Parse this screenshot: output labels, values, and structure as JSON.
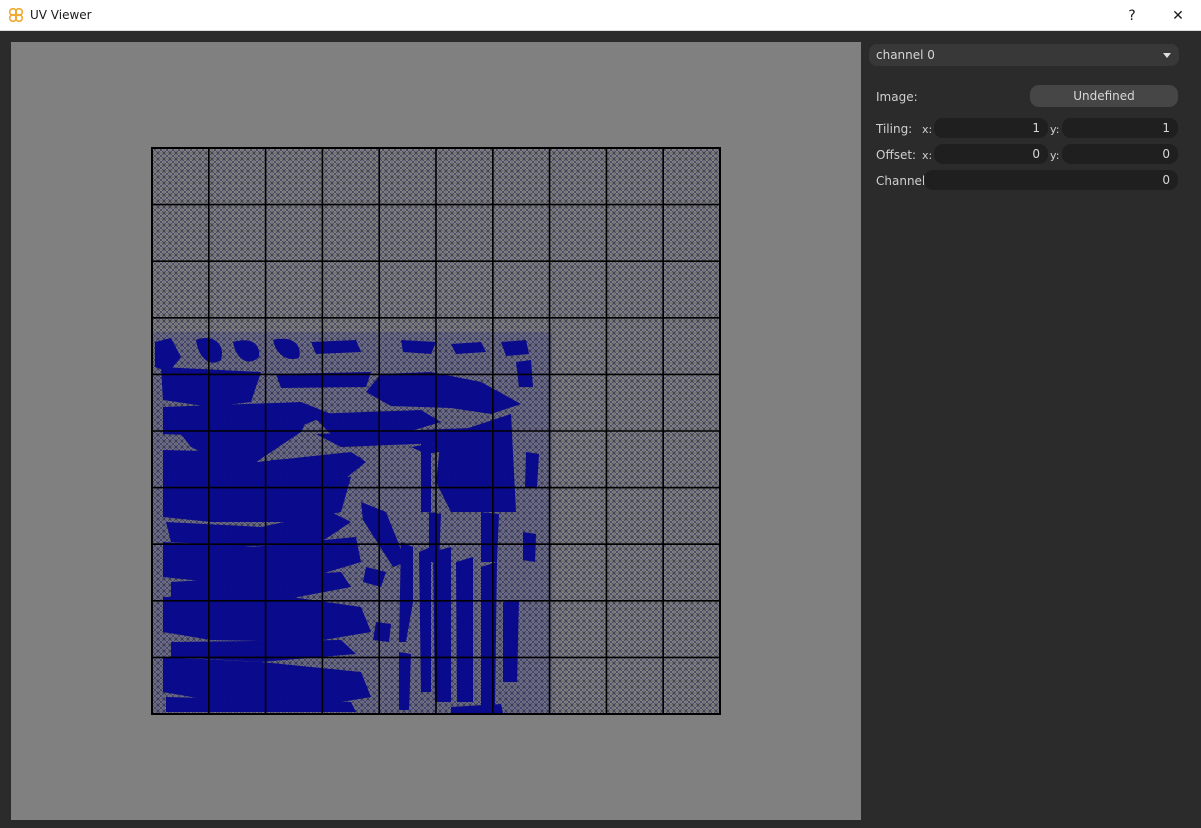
{
  "window": {
    "title": "UV Viewer",
    "help_label": "?",
    "close_label": "✕"
  },
  "panel": {
    "channel_select": "channel 0",
    "image_label": "Image:",
    "image_value": "Undefined",
    "tiling_label": "Tiling:",
    "offset_label": "Offset:",
    "channel_label": "Channel:",
    "x_label": "x:",
    "y_label": "y:",
    "tiling_x": "1",
    "tiling_y": "1",
    "offset_x": "0",
    "offset_y": "0",
    "channel_value": "0"
  },
  "colors": {
    "viewport_bg": "#808080",
    "uv_fill": "#0a0a8c",
    "grid": "#000000",
    "accent_icon": "#f0a830"
  },
  "icons": [
    "app-logo-icon",
    "help-icon",
    "close-icon",
    "chevron-down-icon"
  ]
}
